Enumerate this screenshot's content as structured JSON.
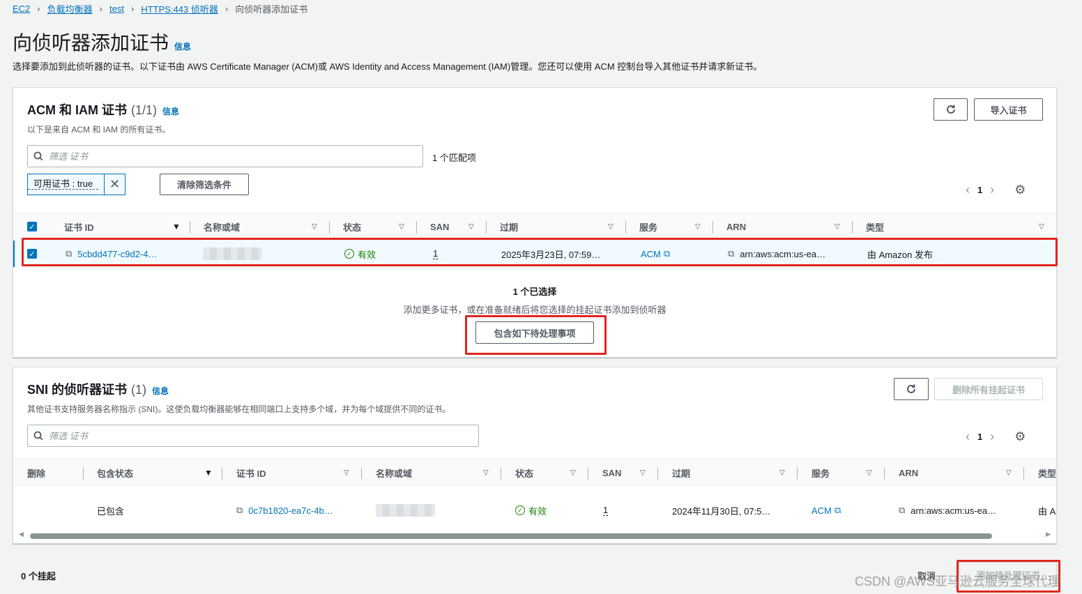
{
  "breadcrumb": {
    "items": [
      "EC2",
      "负载均衡器",
      "test",
      "HTTPS:443 侦听器"
    ],
    "current": "向侦听器添加证书"
  },
  "page": {
    "title": "向侦听器添加证书",
    "info": "信息",
    "description": "选择要添加到此侦听器的证书。以下证书由 AWS Certificate Manager (ACM)或 AWS Identity and Access Management (IAM)管理。您还可以使用 ACM 控制台导入其他证书并请求新证书。"
  },
  "acm_panel": {
    "title": "ACM 和 IAM 证书",
    "count": "(1/1)",
    "info": "信息",
    "description": "以下是来自 ACM 和 IAM 的所有证书。",
    "refresh_icon": "refresh-icon",
    "import_button": "导入证书",
    "search_placeholder": "筛选 证书",
    "match_count": "1 个匹配项",
    "filter_token": "可用证书 : true",
    "clear_filters": "清除筛选条件",
    "page_number": "1",
    "columns": [
      "证书 ID",
      "名称或域",
      "状态",
      "SAN",
      "过期",
      "服务",
      "ARN",
      "类型"
    ],
    "row": {
      "cert_id": "5cbdd477-c9d2-4…",
      "status": "有效",
      "san": "1",
      "expiry": "2025年3月23日, 07:59…",
      "service": "ACM",
      "arn": "arn:aws:acm:us-ea…",
      "type": "由 Amazon 发布"
    },
    "selected_count": "1 个已选择",
    "selected_hint": "添加更多证书，或在准备就绪后将您选择的挂起证书添加到侦听器",
    "include_pending_button": "包含如下待处理事项"
  },
  "sni_panel": {
    "title": "SNI 的侦听器证书",
    "count": "(1)",
    "info": "信息",
    "description": "其他证书支持服务器名称指示 (SNI)。这使负载均衡器能够在相同端口上支持多个域，并为每个域提供不同的证书。",
    "remove_all_button": "删除所有挂起证书",
    "search_placeholder": "筛选 证书",
    "page_number": "1",
    "columns": [
      "删除",
      "包含状态",
      "证书 ID",
      "名称或域",
      "状态",
      "SAN",
      "过期",
      "服务",
      "ARN",
      "类型"
    ],
    "row": {
      "include_status": "已包含",
      "cert_id": "0c7b1820-ea7c-4b…",
      "status": "有效",
      "san": "1",
      "expiry": "2024年11月30日, 07:5…",
      "service": "ACM",
      "arn": "arn:aws:acm:us-ea…",
      "type": "由 A"
    }
  },
  "footer": {
    "pending_count": "0 个挂起",
    "cancel": "取消",
    "add_pending": "添加待处理证书",
    "watermark": "CSDN @AWS亚马逊云服务全球代理"
  },
  "colors": {
    "link": "#0073bb",
    "success": "#1d8102",
    "highlight_border": "#e0251f"
  }
}
